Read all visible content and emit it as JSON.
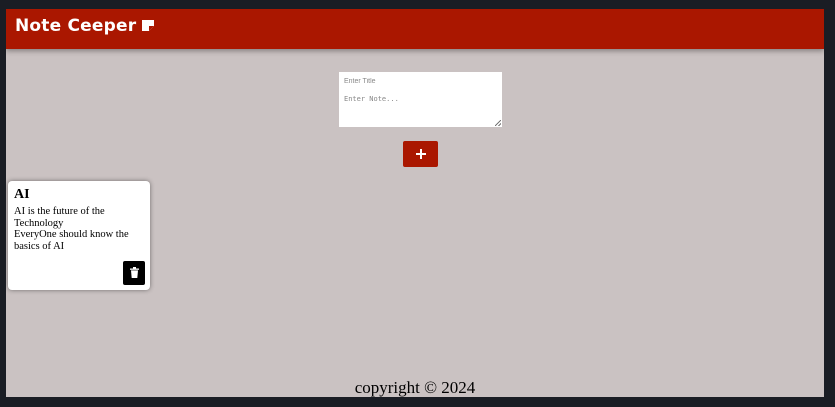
{
  "header": {
    "title": "Note Ceeper",
    "icon": "note-icon"
  },
  "form": {
    "title_placeholder": "Enter Title",
    "note_placeholder": "Enter Note...",
    "add_icon": "plus-icon"
  },
  "notes": [
    {
      "title": "AI",
      "content": "AI is the future of the Technology\nEveryOne should know the basics of AI",
      "delete_icon": "trash-icon"
    }
  ],
  "footer": {
    "text": "copyright © 2024"
  },
  "colors": {
    "header_bg": "#aa1700",
    "page_bg": "#cac2c2",
    "button_bg": "#aa1700",
    "delete_bg": "#000000"
  }
}
